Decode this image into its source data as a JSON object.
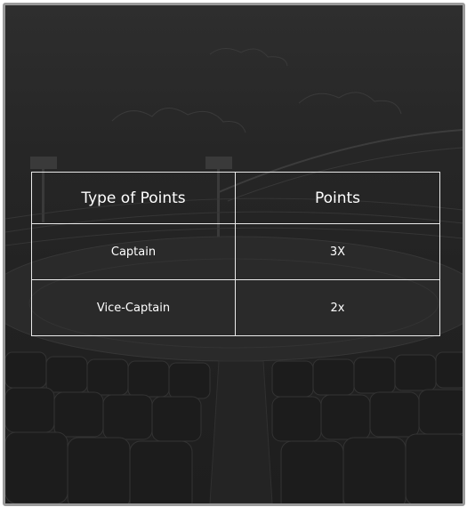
{
  "table": {
    "headers": [
      "Type of Points",
      "Points"
    ],
    "rows": [
      {
        "type": "Captain",
        "points": "3X"
      },
      {
        "type": "Vice-Captain",
        "points": "2x"
      }
    ]
  },
  "colors": {
    "background": "#262626",
    "text": "#ffffff",
    "border": "#e9e9e9",
    "frame_border": "#9a9a9a"
  },
  "background_image": "stadium-sketch-illustration"
}
